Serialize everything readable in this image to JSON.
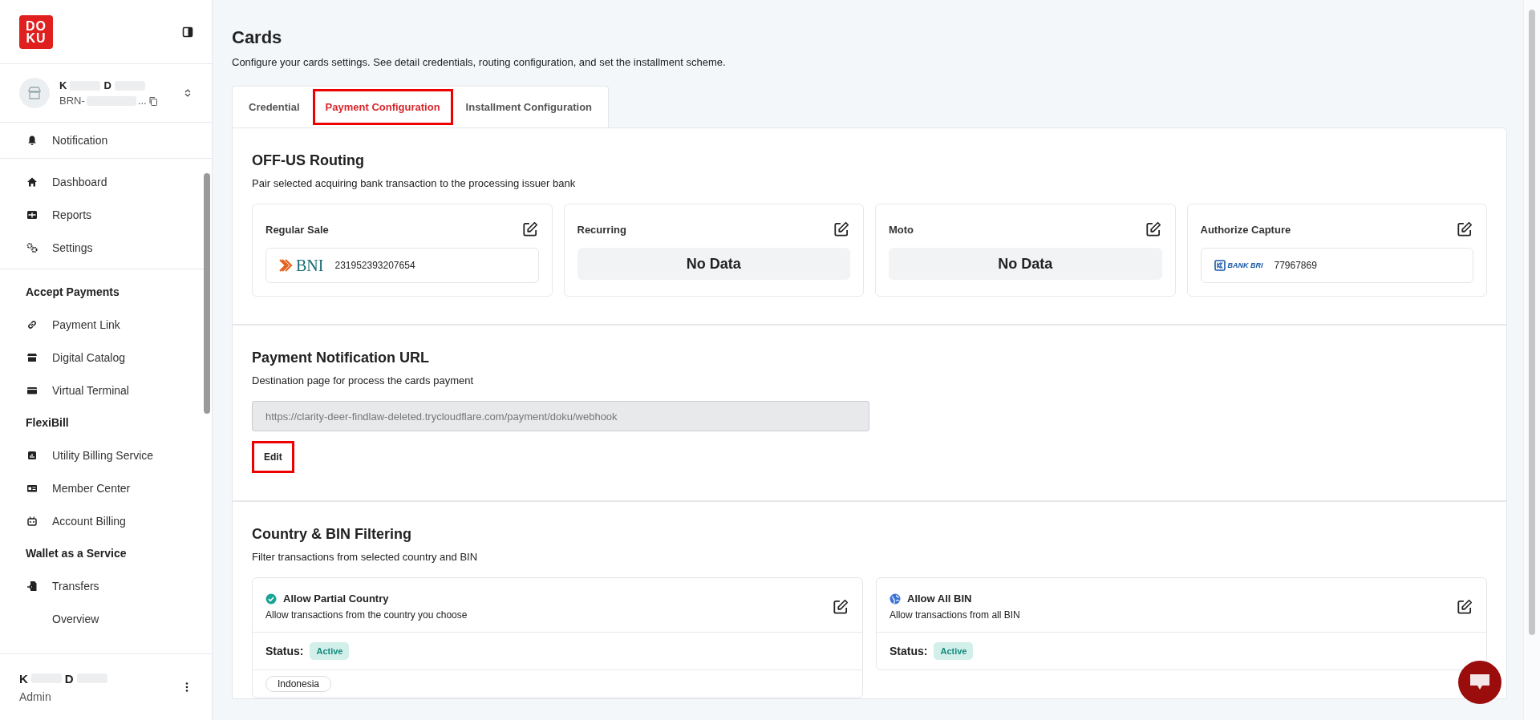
{
  "sidebar": {
    "logo": [
      "DO",
      "KU"
    ],
    "account": {
      "name_parts": [
        "K",
        "D"
      ],
      "id_prefix": "BRN-",
      "id_suffix": "..."
    },
    "notification": "Notification",
    "groups": [
      {
        "items": [
          "Dashboard",
          "Reports",
          "Settings"
        ]
      },
      {
        "heading": "Accept Payments",
        "items": [
          "Payment Link",
          "Digital Catalog",
          "Virtual Terminal"
        ]
      },
      {
        "heading": "FlexiBill",
        "items": [
          "Utility Billing Service",
          "Member Center",
          "Account Billing"
        ]
      },
      {
        "heading": "Wallet as a Service",
        "items": [
          "Transfers",
          "Overview"
        ]
      }
    ],
    "user": {
      "name_parts": [
        "K",
        "D"
      ],
      "role": "Admin"
    }
  },
  "page": {
    "title": "Cards",
    "subtitle": "Configure your cards settings. See detail credentials, routing configuration, and set the installment scheme."
  },
  "tabs": [
    {
      "label": "Credential",
      "selected": false,
      "highlighted": false
    },
    {
      "label": "Payment Configuration",
      "selected": true,
      "highlighted": true
    },
    {
      "label": "Installment Configuration",
      "selected": false,
      "highlighted": false
    }
  ],
  "routing": {
    "title": "OFF-US Routing",
    "subtitle": "Pair selected acquiring bank transaction to the processing issuer bank",
    "cards": [
      {
        "title": "Regular Sale",
        "kind": "bank",
        "bank": "BNI",
        "account": "231952393207654"
      },
      {
        "title": "Recurring",
        "kind": "empty",
        "empty_text": "No Data"
      },
      {
        "title": "Moto",
        "kind": "empty",
        "empty_text": "No Data"
      },
      {
        "title": "Authorize Capture",
        "kind": "bank",
        "bank": "BANK BRI",
        "account": "77967869"
      }
    ]
  },
  "notification_url": {
    "title": "Payment Notification URL",
    "subtitle": "Destination page for process the cards payment",
    "value": "https://clarity-deer-findlaw-deleted.trycloudflare.com/payment/doku/webhook",
    "edit_button": {
      "label": "Edit",
      "highlighted": true
    }
  },
  "filtering": {
    "title": "Country & BIN Filtering",
    "subtitle": "Filter transactions from selected country and BIN",
    "cards": [
      {
        "kind": "check",
        "title": "Allow Partial Country",
        "description": "Allow transactions from the country you choose",
        "status_label": "Status:",
        "status": "Active",
        "chips": [
          "Indonesia"
        ]
      },
      {
        "kind": "globe",
        "title": "Allow All BIN",
        "description": "Allow transactions from all BIN",
        "status_label": "Status:",
        "status": "Active"
      }
    ]
  }
}
